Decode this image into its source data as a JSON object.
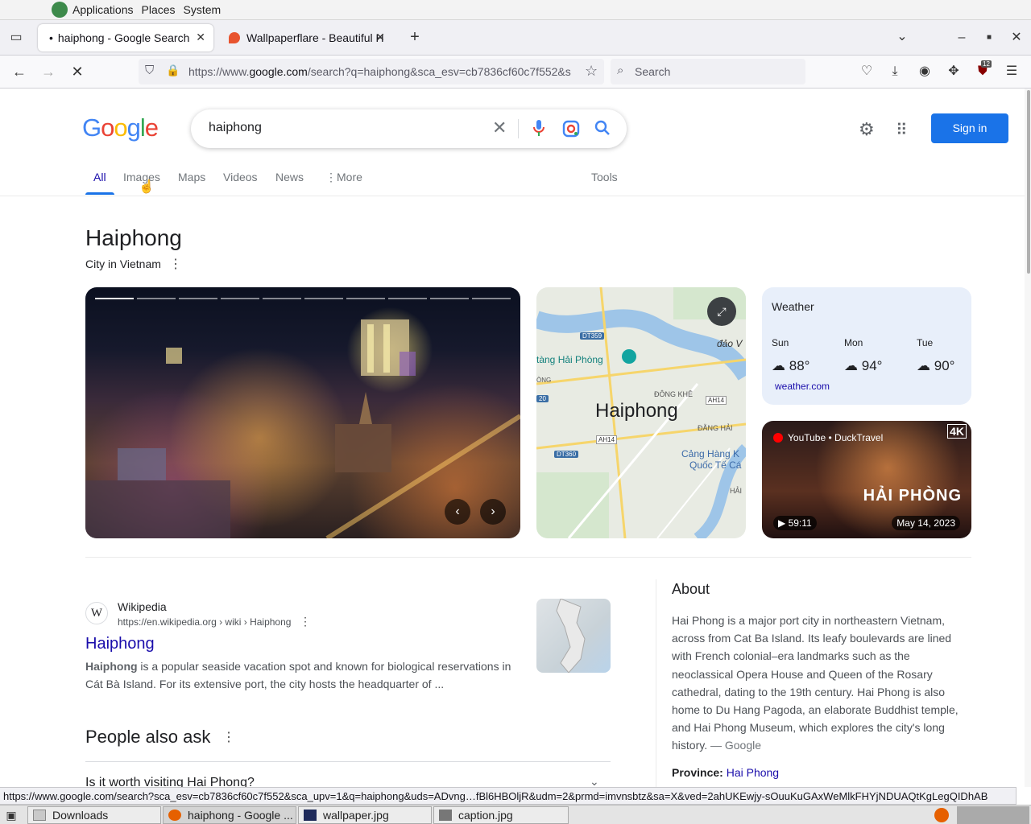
{
  "system_menu": {
    "items": [
      "Applications",
      "Places",
      "System"
    ]
  },
  "browser": {
    "tabs": [
      {
        "title": "haiphong - Google Search",
        "prefix": "•"
      },
      {
        "title": "Wallpaperflare - Beautiful H"
      }
    ],
    "new_tab_label": "+",
    "url_prefix": "https://www.",
    "url_domain": "google.com",
    "url_rest": "/search?q=haiphong&sca_esv=cb7836cf60c7f552&s",
    "search_placeholder": "Search",
    "extension_badge": "12",
    "status_url": "https://www.google.com/search?sca_esv=cb7836cf60c7f552&sca_upv=1&q=haiphong&uds=ADvng…fBl6HBOljR&udm=2&prmd=imvnsbtz&sa=X&ved=2ahUKEwjy-sOuuKuGAxWeMlkFHYjNDUAQtKgLegQIDhAB"
  },
  "google": {
    "logo_letters": [
      {
        "ch": "G",
        "color": "#4285f4"
      },
      {
        "ch": "o",
        "color": "#ea4335"
      },
      {
        "ch": "o",
        "color": "#fbbc05"
      },
      {
        "ch": "g",
        "color": "#4285f4"
      },
      {
        "ch": "l",
        "color": "#34a853"
      },
      {
        "ch": "e",
        "color": "#ea4335"
      }
    ],
    "query": "haiphong",
    "sign_in": "Sign in",
    "tabs": [
      "All",
      "Images",
      "Maps",
      "Videos",
      "News",
      "More"
    ],
    "tools": "Tools"
  },
  "knowledge_panel": {
    "title": "Haiphong",
    "subtitle": "City in Vietnam",
    "map": {
      "title": "Haiphong",
      "labels": [
        "đảo V",
        "tàng Hải Phòng",
        "ĐÔNG KHÊ",
        "ĐẰNG HẢI",
        "Cảng Hàng K",
        "Quốc Tế Cá",
        "HẢI",
        "ÒNG"
      ],
      "road_tags": [
        "DT359",
        "AH14",
        "AH14",
        "DT360",
        "20"
      ]
    },
    "weather": {
      "heading": "Weather",
      "days": [
        {
          "day": "Sun",
          "temp": "88°"
        },
        {
          "day": "Mon",
          "temp": "94°"
        },
        {
          "day": "Tue",
          "temp": "90°"
        }
      ],
      "source": "weather.com"
    },
    "video": {
      "source": "YouTube • DuckTravel",
      "overlay_title": "HẢI PHÒNG",
      "badge": "4K",
      "duration": "59:11",
      "date": "May 14, 2023"
    }
  },
  "result": {
    "site": "Wikipedia",
    "cite": "https://en.wikipedia.org › wiki › Haiphong",
    "title": "Haiphong",
    "snippet_bold": "Haiphong",
    "snippet_rest": " is a popular seaside vacation spot and known for biological reservations in Cát Bà Island. For its extensive port, the city hosts the headquarter of ..."
  },
  "people_also_ask": {
    "heading": "People also ask",
    "first_question": "Is it worth visiting Hai Phong?"
  },
  "about": {
    "heading": "About",
    "text": "Hai Phong is a major port city in northeastern Vietnam, across from Cat Ba Island. Its leafy boulevards are lined with French colonial–era landmarks such as the neoclassical Opera House and Queen of the Rosary cathedral, dating to the 19th century. Hai Phong is also home to Du Hang Pagoda, an elaborate Buddhist temple, and Hai Phong Museum, which explores the city's long history.",
    "source": " — Google",
    "province_label": "Province:",
    "province_value": "Hai Phong"
  },
  "taskbar": {
    "items": [
      "Downloads",
      "haiphong - Google ...",
      "wallpaper.jpg",
      "caption.jpg"
    ]
  }
}
